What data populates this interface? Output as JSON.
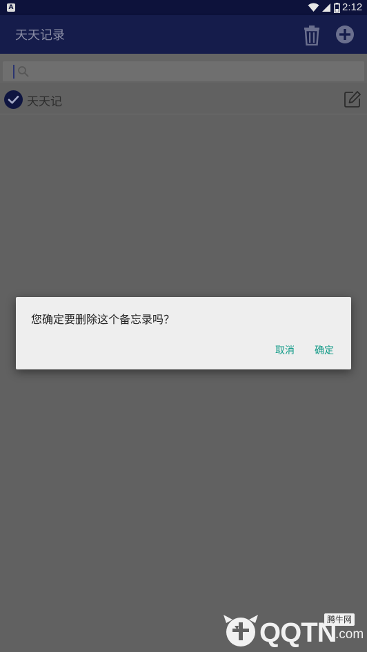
{
  "status_bar": {
    "time": "2:12",
    "notification_icon": "a-notification-icon",
    "icons": [
      "wifi-icon",
      "signal-icon",
      "battery-icon"
    ]
  },
  "app_bar": {
    "title": "天天记录",
    "actions": [
      "trash-icon",
      "add-circle-icon"
    ]
  },
  "search": {
    "value": "",
    "placeholder": "",
    "icon": "search-icon"
  },
  "memos": [
    {
      "title": "天天记",
      "checked": true
    }
  ],
  "dialog": {
    "message": "您确定要删除这个备忘录吗？",
    "cancel_label": "取消",
    "confirm_label": "确定"
  },
  "watermark": {
    "brand": "QQTN",
    "suffix": ".com",
    "badge": "腾牛网"
  },
  "colors": {
    "status_bar": "#0d123b",
    "app_bar": "#151c4b",
    "scrim_background": "#616161",
    "dialog_background": "#eeeeee",
    "dialog_button": "#129b88",
    "check": "#0f1540"
  }
}
